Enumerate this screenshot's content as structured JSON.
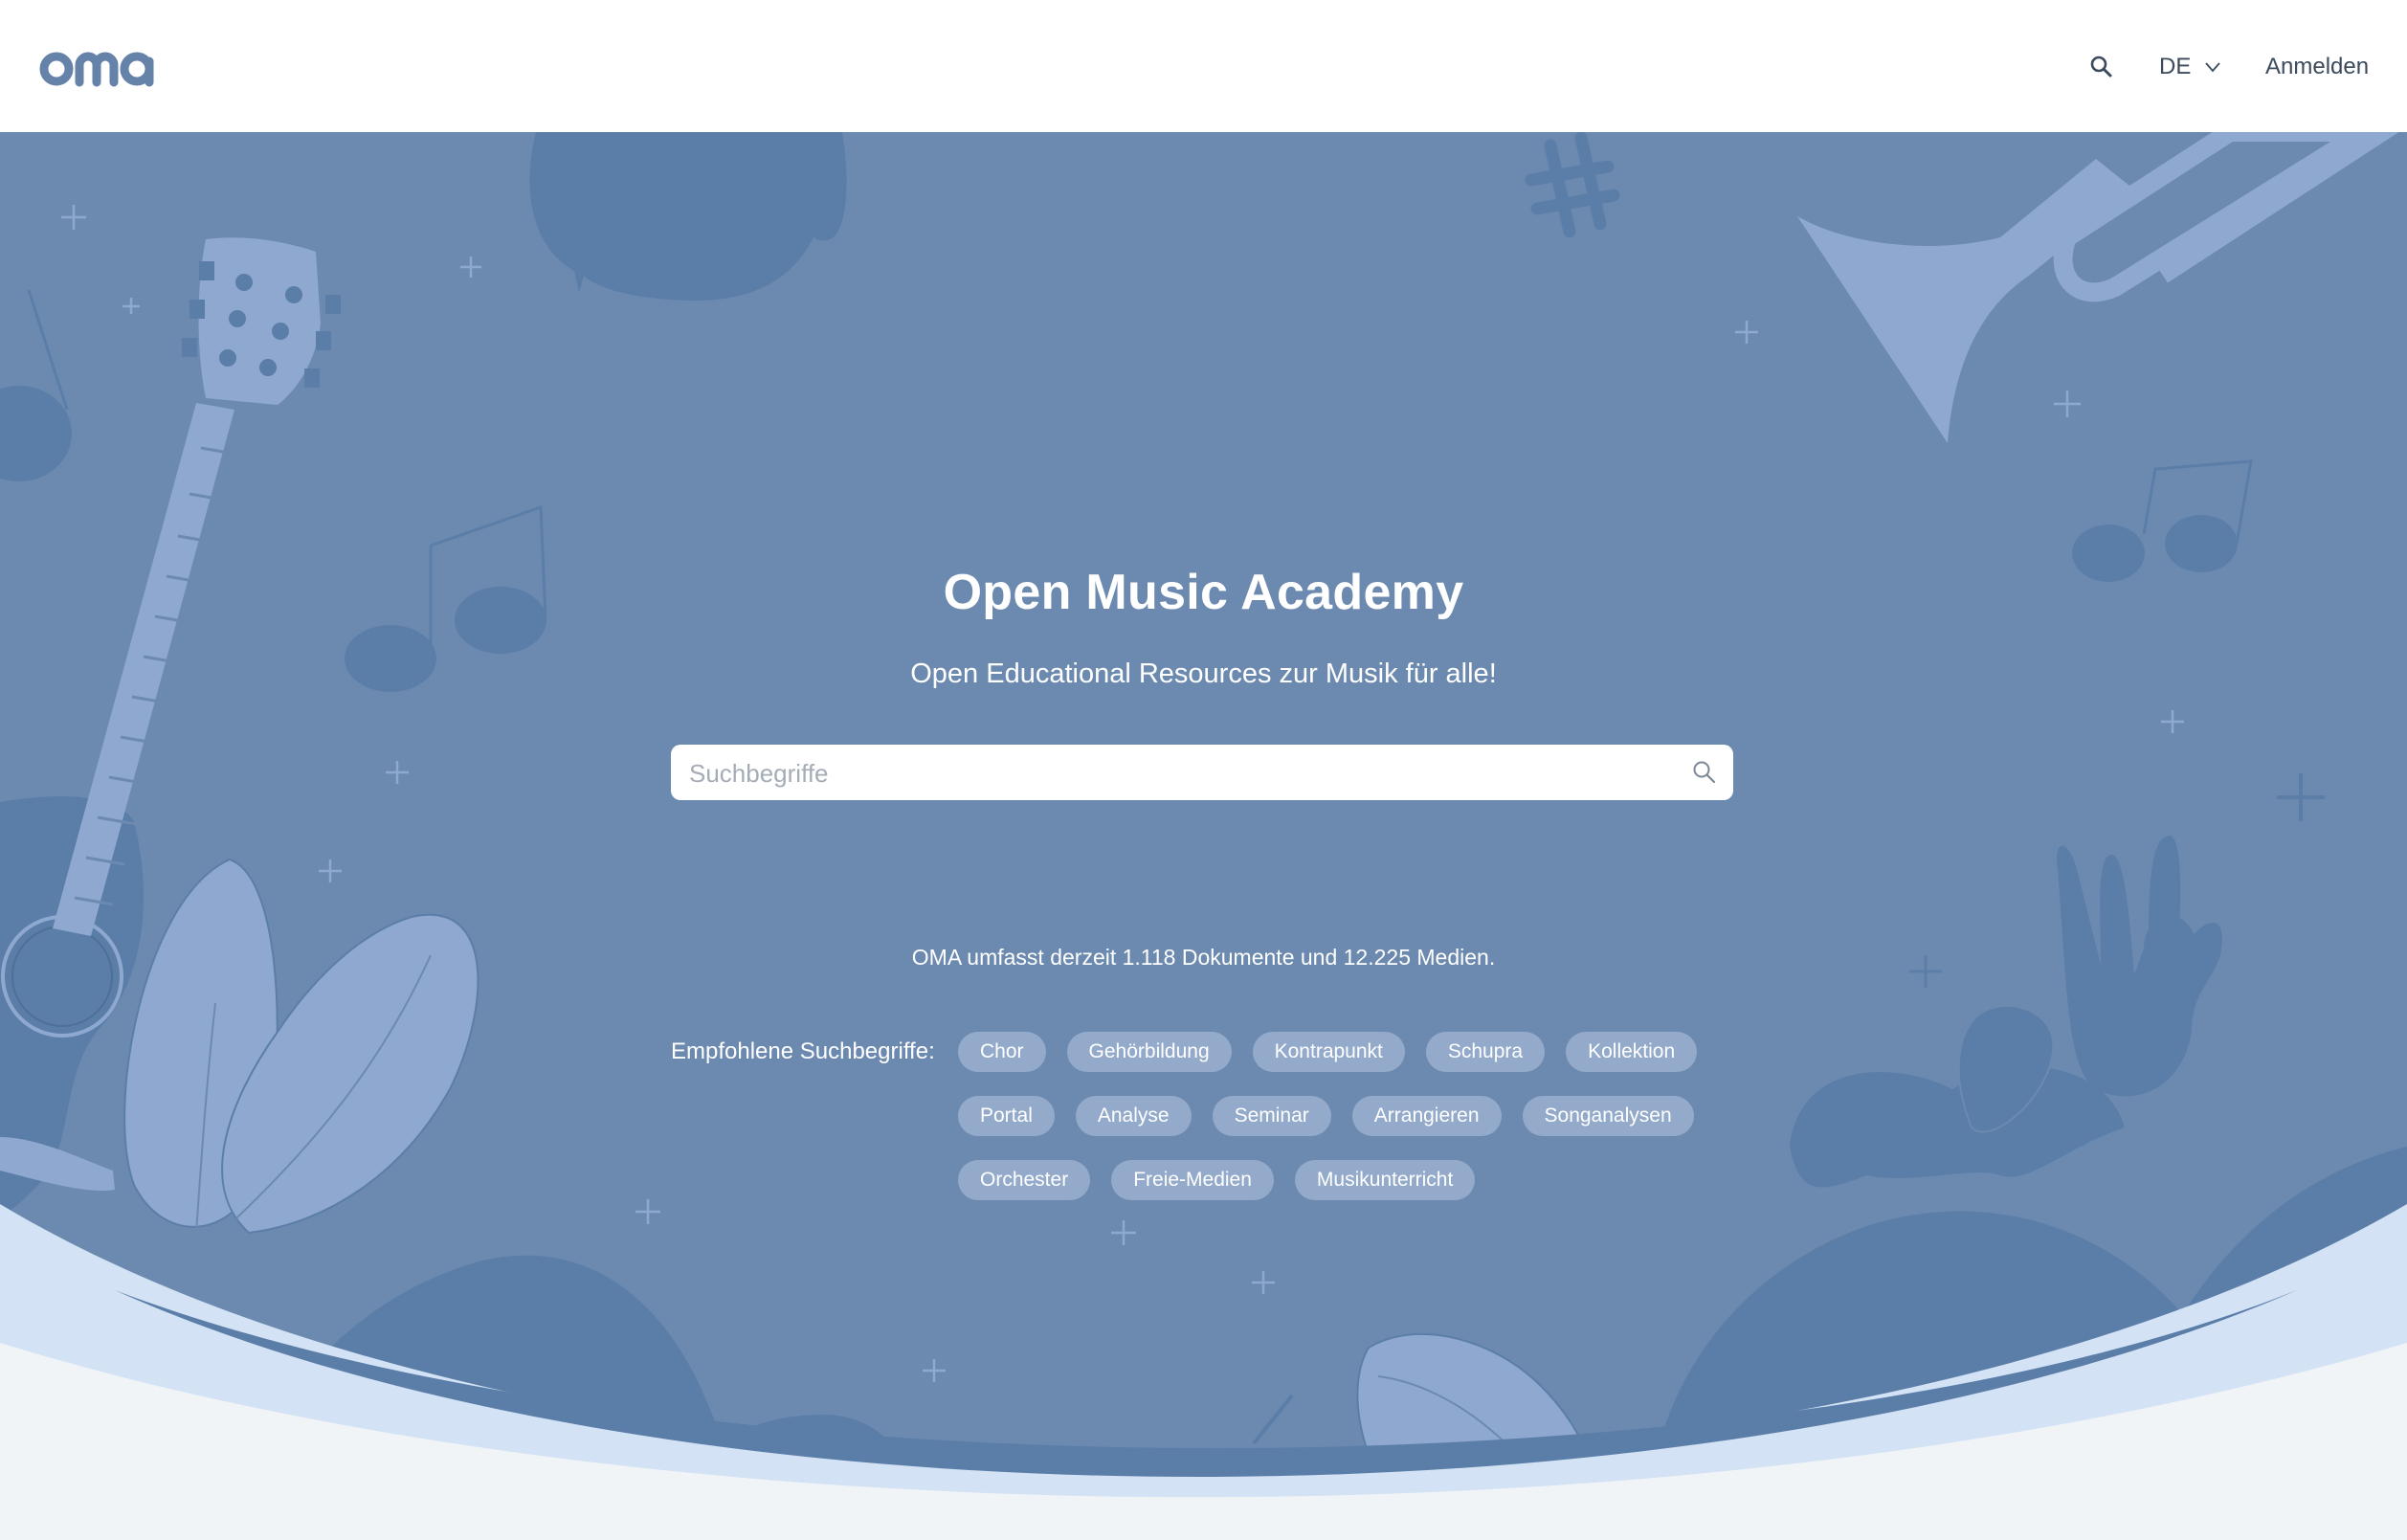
{
  "header": {
    "logo_text": "oma",
    "search_icon": "search-icon",
    "language": "DE",
    "language_icon": "chevron-down-icon",
    "login_label": "Anmelden"
  },
  "hero": {
    "title": "Open Music Academy",
    "subtitle": "Open Educational Resources zur Musik für alle!",
    "search": {
      "placeholder": "Suchbegriffe",
      "value": "",
      "icon": "search-icon"
    },
    "stats": "OMA umfasst derzeit 1.118 Dokumente und 12.225 Medien.",
    "suggestions_label": "Empfohlene Suchbegriffe:",
    "tags": [
      "Chor",
      "Gehörbildung",
      "Kontrapunkt",
      "Schupra",
      "Kollektion",
      "Portal",
      "Analyse",
      "Seminar",
      "Arrangieren",
      "Songanalysen",
      "Orchester",
      "Freie-Medien",
      "Musikunterricht"
    ]
  },
  "colors": {
    "hero_bg": "#6c8ab0",
    "hero_dark": "#5b7ea8",
    "hero_light": "#8ea8cf",
    "wave_light": "#d3e2f5",
    "page_bg": "#f1f4f7",
    "logo": "#6582a8",
    "tag_bg": "#93aacb"
  }
}
